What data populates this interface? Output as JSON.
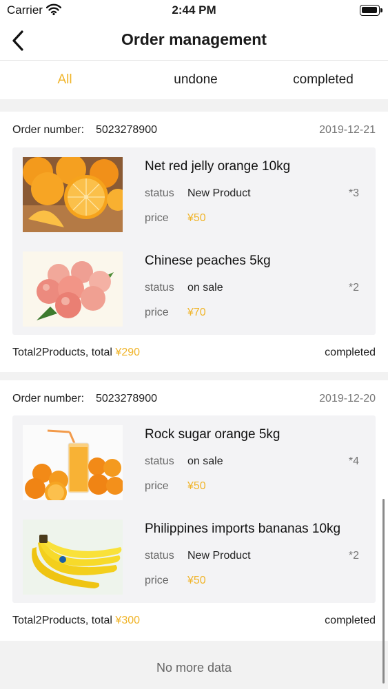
{
  "status_bar": {
    "carrier": "Carrier",
    "time": "2:44 PM"
  },
  "nav": {
    "title": "Order management"
  },
  "tabs": [
    {
      "label": "All",
      "active": true
    },
    {
      "label": "undone",
      "active": false
    },
    {
      "label": "completed",
      "active": false
    }
  ],
  "orders": [
    {
      "number_label": "Order number:",
      "number": "5023278900",
      "date": "2019-12-21",
      "products": [
        {
          "name": "Net red jelly orange 10kg",
          "status_label": "status",
          "status": "New Product",
          "price_label": "price",
          "price": "¥50",
          "quantity": "*3",
          "image": "orange-image"
        },
        {
          "name": "Chinese peaches 5kg",
          "status_label": "status",
          "status": "on sale",
          "price_label": "price",
          "price": "¥70",
          "quantity": "*2",
          "image": "peach-image"
        }
      ],
      "total_text": "Total2Products, total ",
      "total_amount": "¥290",
      "status": "completed"
    },
    {
      "number_label": "Order number:",
      "number": "5023278900",
      "date": "2019-12-20",
      "products": [
        {
          "name": "Rock sugar orange 5kg",
          "status_label": "status",
          "status": "on sale",
          "price_label": "price",
          "price": "¥50",
          "quantity": "*4",
          "image": "orange-juice-image"
        },
        {
          "name": "Philippines imports bananas 10kg",
          "status_label": "status",
          "status": "New Product",
          "price_label": "price",
          "price": "¥50",
          "quantity": "*2",
          "image": "banana-image"
        }
      ],
      "total_text": "Total2Products, total ",
      "total_amount": "¥300",
      "status": "completed"
    }
  ],
  "footer": {
    "no_more": "No more data"
  },
  "colors": {
    "accent": "#f0b429",
    "background": "#f2f2f2",
    "card": "#ffffff",
    "product_box": "#f3f3f5"
  }
}
